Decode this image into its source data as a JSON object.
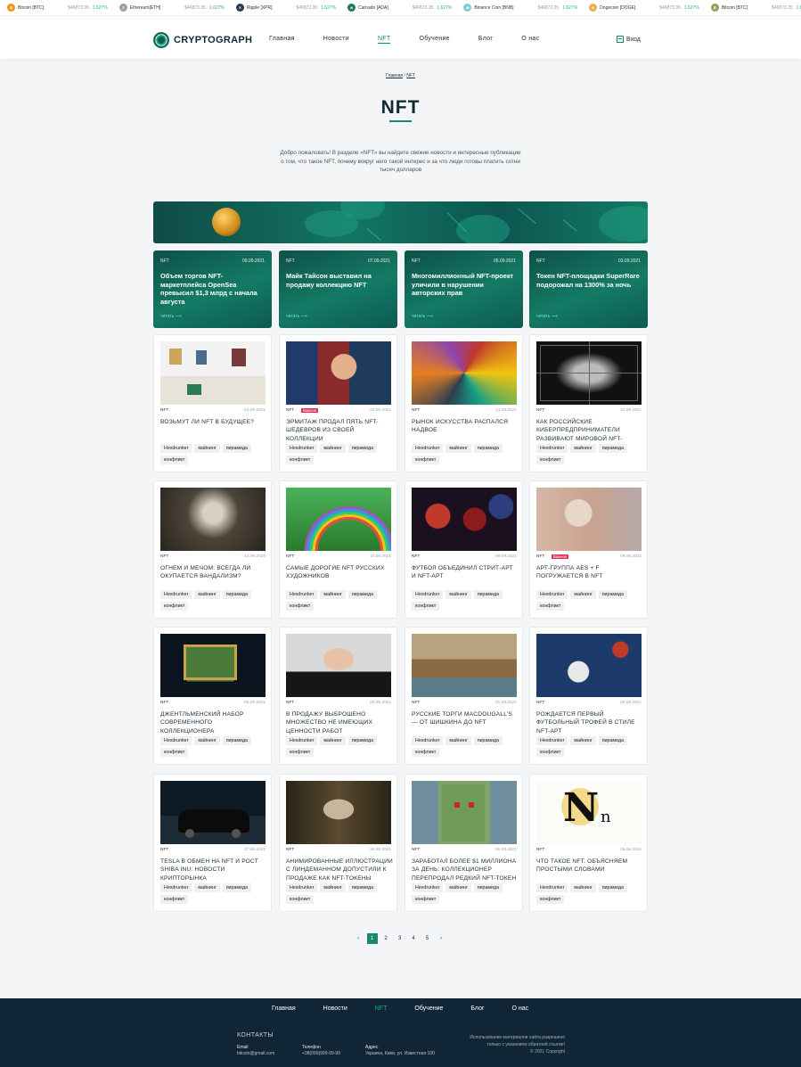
{
  "ticker": [
    {
      "name": "Bitcoin [BTC]",
      "price": "$46873.35",
      "change": "1.627%",
      "color": "#f7931a",
      "glyph": "₿"
    },
    {
      "name": "Ethereum[ETH]",
      "price": "$46873.35",
      "change": "1.627%",
      "color": "#9aa0a6",
      "glyph": "Ξ"
    },
    {
      "name": "Ripple [XPR]",
      "price": "$46873.35",
      "change": "1.627%",
      "color": "#2a3a4a",
      "glyph": "✕"
    },
    {
      "name": "Carnado [ADA]",
      "price": "$46873.35",
      "change": "1.627%",
      "color": "#1c7a5a",
      "glyph": "₳"
    },
    {
      "name": "Binance Coin [BNB]",
      "price": "$46873.35",
      "change": "1.627%",
      "color": "#7fcfd4",
      "glyph": "◆"
    },
    {
      "name": "Dogecoin [DOGE]",
      "price": "$46873.35",
      "change": "1.627%",
      "color": "#e8b04a",
      "glyph": "Ð"
    },
    {
      "name": "Bitcoin [BTC]",
      "price": "$46873.35",
      "change": "1.627%",
      "color": "#9c9a55",
      "glyph": "₿"
    },
    {
      "name": "Bitcoin [BTC]",
      "price": "",
      "change": "",
      "color": "#f7931a",
      "glyph": "₿"
    }
  ],
  "header": {
    "logo": "CRYPTOGRAPH",
    "nav": [
      {
        "label": "Главная"
      },
      {
        "label": "Новости"
      },
      {
        "label": "NFT"
      },
      {
        "label": "Обучение"
      },
      {
        "label": "Блог"
      },
      {
        "label": "О нас"
      }
    ],
    "login": "Вход"
  },
  "breadcrumb": {
    "home": "Главная",
    "sep": " / ",
    "current": "NFT"
  },
  "page_title": "NFT",
  "intro": "Добро пожаловать! В разделе «NFT» вы найдете свежие новости и интересные публикации о том, что такое NFT, почему вокруг него такой интерес и за что люди готовы платить сотни тысяч долларов",
  "featured": [
    {
      "cat": "NFT",
      "date": "09.09.2021",
      "title": "Объем торгов NFT-маркетплейса OpenSea превысил $1,3 млрд с начала августа",
      "read": "читать ⟶"
    },
    {
      "cat": "NFT",
      "date": "07.09.2021",
      "title": "Майк Тайсон выставил на продажу коллекцию NFT",
      "read": "читать ⟶"
    },
    {
      "cat": "NFT",
      "date": "05.09.2021",
      "title": "Многомиллионный NFT-проект уличили в нарушении авторских прав",
      "read": "читать ⟶"
    },
    {
      "cat": "NFT",
      "date": "03.09.2021",
      "title": "Токен NFT-площадки SuperRare подорожал на 1300% за ночь",
      "read": "читать ⟶"
    }
  ],
  "cards": [
    {
      "cat": "NFT",
      "date": "23.09.2021",
      "badge": "",
      "title": "Возьмут ли NFT в будущее?",
      "tags": [
        "Hexdrunker",
        "майнинг",
        "пирамида",
        "конфликт"
      ],
      "img": "gallery"
    },
    {
      "cat": "NFT",
      "date": "20.09.2021",
      "badge": "Важное",
      "title": "Эрмитаж продал пять NFT-шедевров из своей коллекции",
      "tags": [
        "Hexdrunker",
        "майнинг",
        "пирамида",
        "конфликт"
      ],
      "img": "madonna"
    },
    {
      "cat": "NFT",
      "date": "13.09.2021",
      "badge": "",
      "title": "Рынок искусства распался надвое",
      "tags": [
        "Hexdrunker",
        "майнинг",
        "пирамида",
        "конфликт"
      ],
      "img": "abstract"
    },
    {
      "cat": "NFT",
      "date": "10.09.2021",
      "badge": "",
      "title": "Как российские киберпредприниматели развивают мировой NFT-рынок",
      "tags": [
        "Hexdrunker",
        "майнинг",
        "пирамида",
        "конфликт"
      ],
      "img": "wire"
    },
    {
      "cat": "NFT",
      "date": "14.09.2021",
      "badge": "",
      "title": "Огнем и мечом: всегда ли окупается вандализм?",
      "tags": [
        "Hexdrunker",
        "майнинг",
        "пирамида",
        "конфликт"
      ],
      "img": "etching"
    },
    {
      "cat": "NFT",
      "date": "10.09.2021",
      "badge": "",
      "title": "Самые дорогие NFT русских художников",
      "tags": [
        "Hexdrunker",
        "майнинг",
        "пирамида",
        "конфликт"
      ],
      "img": "rainbow"
    },
    {
      "cat": "NFT",
      "date": "09.09.2021",
      "badge": "",
      "title": "Футбол объединил стрит-арт и NFT-арт",
      "tags": [
        "Hexdrunker",
        "майнинг",
        "пирамида",
        "конфликт"
      ],
      "img": "balls"
    },
    {
      "cat": "NFT",
      "date": "09.09.2021",
      "badge": "Важное",
      "title": "Арт-группа AES + F погружается в NFT",
      "tags": [
        "Hexdrunker",
        "майнинг",
        "пирамида",
        "конфликт"
      ],
      "img": "portrait"
    },
    {
      "cat": "NFT",
      "date": "05.09.2021",
      "badge": "",
      "title": "Джентльменский набор современного коллекционера",
      "tags": [
        "Hexdrunker",
        "майнинг",
        "пирамида",
        "конфликт"
      ],
      "img": "painting"
    },
    {
      "cat": "NFT",
      "date": "03.09.2021",
      "badge": "",
      "title": "В продажу выброшено множество не имеющих ценности работ",
      "tags": [
        "Hexdrunker",
        "майнинг",
        "пирамида",
        "конфликт"
      ],
      "img": "woman"
    },
    {
      "cat": "NFT",
      "date": "01.09.2021",
      "badge": "",
      "title": "Русские торги MacDougall’s — от Шишкина до NFT",
      "tags": [
        "Hexdrunker",
        "майнинг",
        "пирамида",
        "конфликт"
      ],
      "img": "venice"
    },
    {
      "cat": "NFT",
      "date": "29.08.2021",
      "badge": "",
      "title": "Рождается первый футбольный трофей в стиле NFT-арт",
      "tags": [
        "Hexdrunker",
        "майнинг",
        "пирамида",
        "конфликт"
      ],
      "img": "studio"
    },
    {
      "cat": "NFT",
      "date": "27.08.2021",
      "badge": "",
      "title": "Tesla в обмен на NFT и рост Shiba Inu: новости крипторынка",
      "tags": [
        "Hexdrunker",
        "майнинг",
        "пирамида",
        "конфликт"
      ],
      "img": "tesla"
    },
    {
      "cat": "NFT",
      "date": "26.08.2021",
      "badge": "",
      "title": "Анимированные иллюстрации с Линдеманном допустили к продаже как NFT-токены",
      "tags": [
        "Hexdrunker",
        "майнинг",
        "пирамида",
        "конфликт"
      ],
      "img": "lindemann"
    },
    {
      "cat": "NFT",
      "date": "26.08.2021",
      "badge": "",
      "title": "Заработал более $1 миллиона за день: коллекционер перепродал редкий NFT-токен",
      "tags": [
        "Hexdrunker",
        "майнинг",
        "пирамида",
        "конфликт"
      ],
      "img": "punk"
    },
    {
      "cat": "NFT",
      "date": "25.08.2021",
      "badge": "",
      "title": "Что такое NFT. Объясняем простыми словами",
      "tags": [
        "Hexdrunker",
        "майнинг",
        "пирамида",
        "конфликт"
      ],
      "img": "letters"
    }
  ],
  "pagination": {
    "prev": "‹",
    "pages": [
      "1",
      "2",
      "3",
      "4",
      "5"
    ],
    "current": "1",
    "next": "›"
  },
  "footer": {
    "nav": [
      {
        "label": "Главная"
      },
      {
        "label": "Новости"
      },
      {
        "label": "NFT"
      },
      {
        "label": "Обучение"
      },
      {
        "label": "Блог"
      },
      {
        "label": "О нас"
      }
    ],
    "contacts_title": "КОНТАКТЫ",
    "email_label": "Email",
    "email": "bitcoin@gmail.com",
    "phone_label": "Телефон",
    "phone": "+38(099)999-99-99",
    "address_label": "Адрес",
    "address": "Украина, Киев, ул. Известная 100",
    "copyright_1": "Использование материалов сайта разрешено",
    "copyright_2": "только с указанием обратной ссылки!",
    "copyright_3": "© 2021 Copyright"
  },
  "colors": {
    "accent": "#16896f",
    "dark": "#102636",
    "badge": "#e0324f"
  }
}
